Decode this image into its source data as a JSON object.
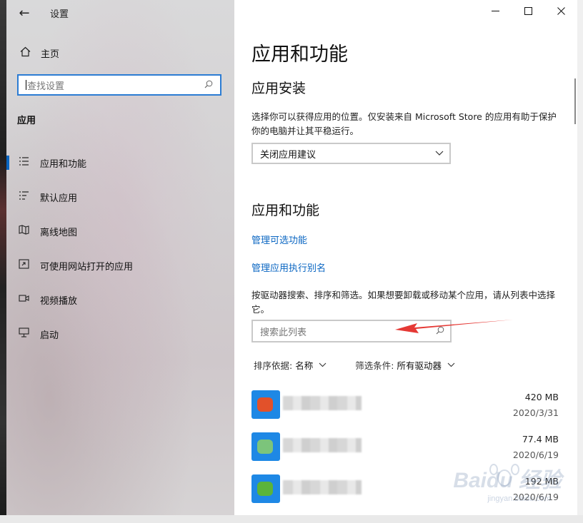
{
  "window": {
    "title": "设置"
  },
  "sidebar": {
    "home_label": "主页",
    "search_placeholder": "查找设置",
    "section_label": "应用",
    "items": [
      {
        "label": "应用和功能",
        "icon": "list-icon",
        "selected": true
      },
      {
        "label": "默认应用",
        "icon": "default-apps-icon",
        "selected": false
      },
      {
        "label": "离线地图",
        "icon": "offline-map-icon",
        "selected": false
      },
      {
        "label": "可使用网站打开的应用",
        "icon": "website-app-icon",
        "selected": false
      },
      {
        "label": "视频播放",
        "icon": "video-icon",
        "selected": false
      },
      {
        "label": "启动",
        "icon": "startup-icon",
        "selected": false
      }
    ]
  },
  "main": {
    "page_title": "应用和功能",
    "install_heading": "应用安装",
    "install_desc": "选择你可以获得应用的位置。仅安装来自 Microsoft Store 的应用有助于保护你的电脑并让其平稳运行。",
    "install_dropdown_value": "关闭应用建议",
    "apps_heading": "应用和功能",
    "link_optional_features": "管理可选功能",
    "link_exec_alias": "管理应用执行别名",
    "search_desc": "按驱动器搜索、排序和筛选。如果想要卸载或移动某个应用，请从列表中选择它。",
    "list_search_placeholder": "搜索此列表",
    "sort_label": "排序依据:",
    "sort_value": "名称",
    "filter_label": "筛选条件:",
    "filter_value": "所有驱动器",
    "apps": [
      {
        "size": "420 MB",
        "date": "2020/3/31",
        "icon_color": "#e2512a"
      },
      {
        "size": "77.4 MB",
        "date": "2020/6/19",
        "icon_color": "#7cc47b"
      },
      {
        "size": "192 MB",
        "date": "2020/6/19",
        "icon_color": "#5bb43a"
      }
    ]
  },
  "watermark": {
    "brand": "Baidu 经验",
    "url": "jingyan.baidu.com"
  },
  "colors": {
    "accent": "#0a66c2",
    "search_focus": "#2b7cd3",
    "annotation_arrow": "#e53935"
  }
}
